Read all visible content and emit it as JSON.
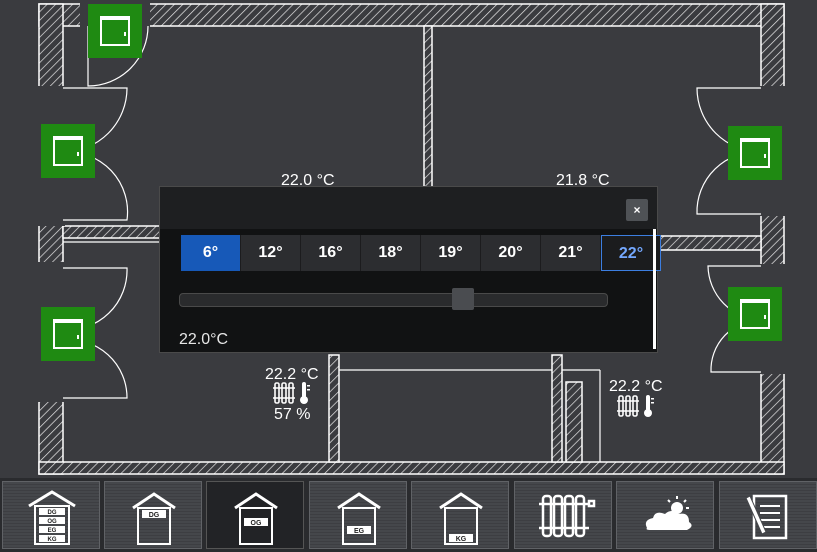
{
  "floorplan": {
    "rooms": [
      {
        "temperature": "22.0 °C"
      },
      {
        "temperature": "21.8 °C"
      },
      {
        "temperature": "22.2 °C",
        "humidity": "57 %"
      },
      {
        "temperature": "22.2 °C"
      }
    ],
    "window_status_color": "#1f8a12"
  },
  "dialog": {
    "close_label": "×",
    "presets": [
      "6°",
      "12°",
      "16°",
      "18°",
      "19°",
      "20°",
      "21°",
      "22°"
    ],
    "selected_preset": "6°",
    "current_preset": "22°",
    "slider_value": 0.67,
    "value_text": "22.0°C"
  },
  "navbar": {
    "items": [
      {
        "icon": "house-all-floors-icon",
        "labels": [
          "DG",
          "OG",
          "EG",
          "KG"
        ]
      },
      {
        "icon": "house-dg-icon",
        "labels": [
          "DG"
        ]
      },
      {
        "icon": "house-og-icon",
        "labels": [
          "OG"
        ]
      },
      {
        "icon": "house-eg-icon",
        "labels": [
          "EG"
        ]
      },
      {
        "icon": "house-kg-icon",
        "labels": [
          "KG"
        ]
      },
      {
        "icon": "radiator-icon"
      },
      {
        "icon": "weather-icon"
      },
      {
        "icon": "notes-icon"
      }
    ],
    "active_index": 2
  }
}
